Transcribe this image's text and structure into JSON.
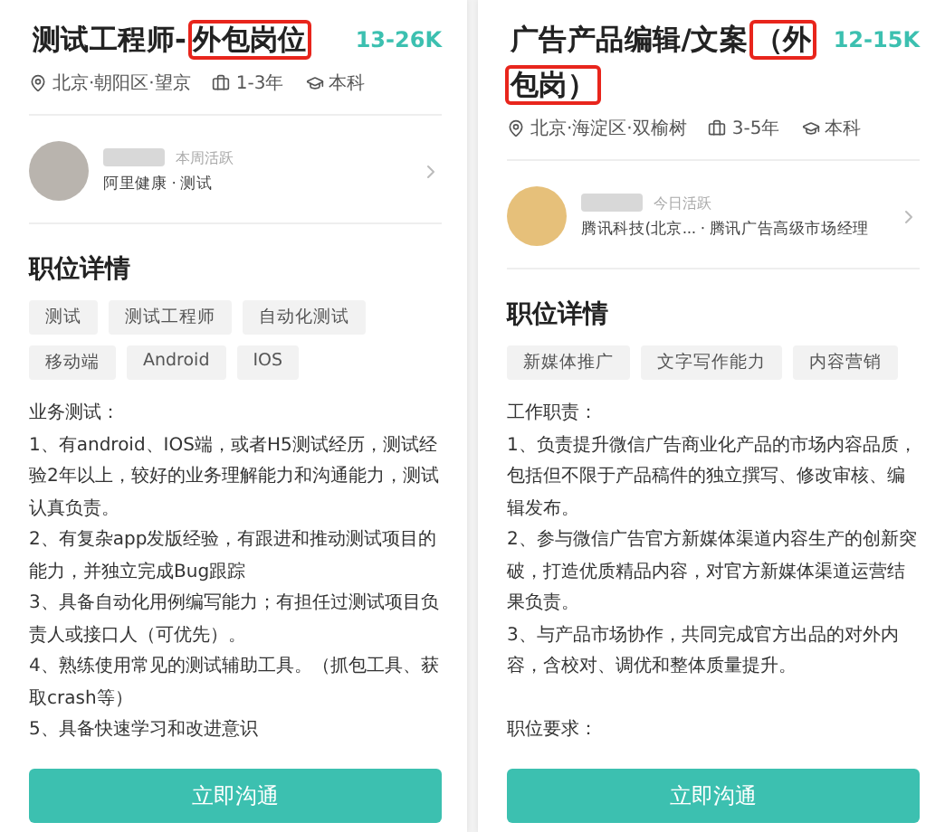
{
  "cards": [
    {
      "title": [
        {
          "text": "测试工程师-",
          "highlighted": false
        },
        {
          "text": "外包岗位",
          "highlighted": true
        }
      ],
      "salary": "13-26K",
      "location": "北京·朝阳区·望京",
      "experience": "1-3年",
      "education": "本科",
      "recruiter": {
        "activity": "本周活跃",
        "company": "阿里健康 · 测试"
      },
      "section_title": "职位详情",
      "tags": [
        "测试",
        "测试工程师",
        "自动化测试",
        "移动端",
        "Android",
        "IOS"
      ],
      "description": [
        "业务测试：",
        "1、有android、IOS端，或者H5测试经历，测试经验2年以上，较好的业务理解能力和沟通能力，测试认真负责。",
        "2、有复杂app发版经验，有跟进和推动测试项目的能力，并独立完成Bug跟踪",
        "3、具备自动化用例编写能力；有担任过测试项目负责人或接口人（可优先）。",
        "4、熟练使用常见的测试辅助工具。（抓包工具、获取crash等）",
        "5、具备快速学习和改进意识"
      ],
      "button": "立即沟通"
    },
    {
      "title": [
        {
          "text": "广告产品编辑/文案",
          "highlighted": false
        },
        {
          "text": "（外",
          "highlighted": true
        },
        {
          "text": "包岗）",
          "highlighted": true
        }
      ],
      "salary": "12-15K",
      "location": "北京·海淀区·双榆树",
      "experience": "3-5年",
      "education": "本科",
      "recruiter": {
        "activity": "今日活跃",
        "company": "腾讯科技(北京... · 腾讯广告高级市场经理"
      },
      "section_title": "职位详情",
      "tags": [
        "新媒体推广",
        "文字写作能力",
        "内容营销"
      ],
      "description": [
        "工作职责：",
        "1、负责提升微信广告商业化产品的市场内容品质，包括但不限于产品稿件的独立撰写、修改审核、编辑发布。",
        "2、参与微信广告官方新媒体渠道内容生产的创新突破，打造优质精品内容，对官方新媒体渠道运营结果负责。",
        "3、与产品市场协作，共同完成官方出品的对外内容，含校对、调优和整体质量提升。"
      ],
      "subheading": "职位要求：",
      "button": "立即沟通"
    }
  ]
}
